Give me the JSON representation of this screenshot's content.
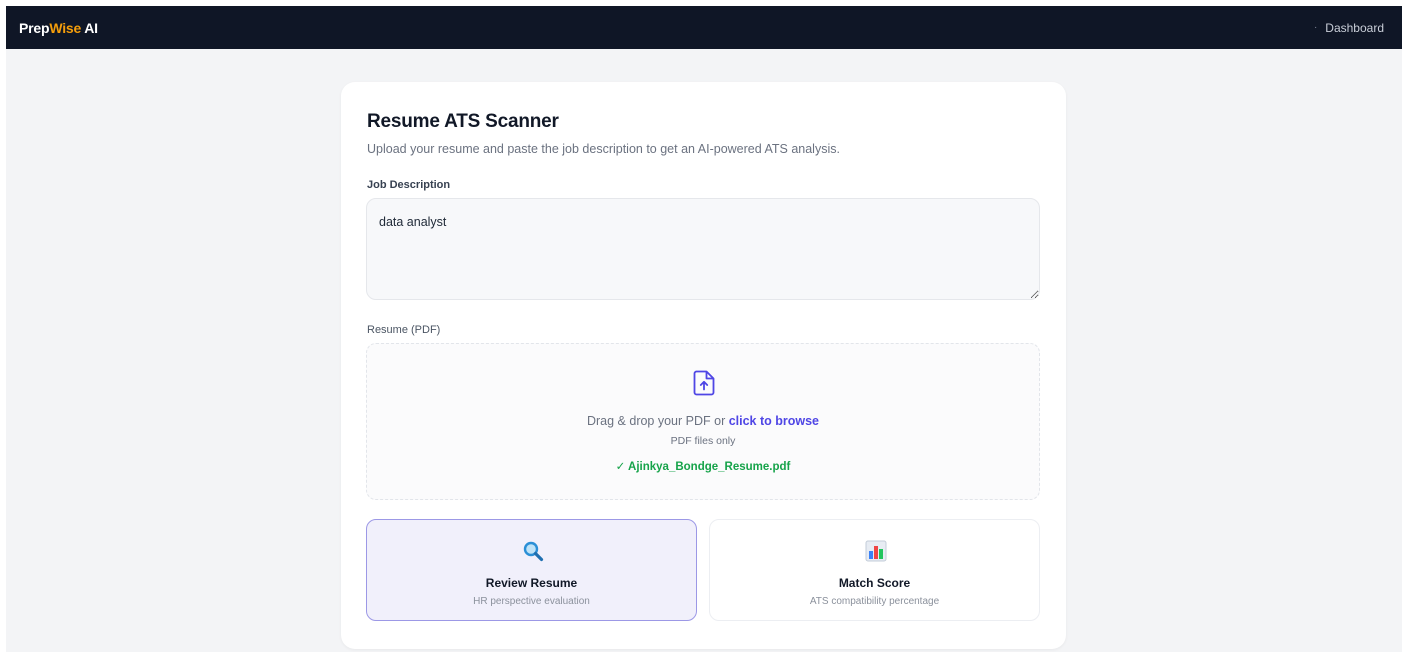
{
  "navbar": {
    "brand_prefix": "Prep",
    "brand_accent": "Wise",
    "brand_suffix": " AI",
    "link_bullet": "·",
    "link_label": "Dashboard"
  },
  "scanner": {
    "title": "Resume ATS Scanner",
    "subtitle": "Upload your resume and paste the job description to get an AI-powered ATS analysis.",
    "job_description": {
      "label": "Job Description",
      "value": "data analyst"
    },
    "resume": {
      "label": "Resume (PDF)",
      "icon": "file-upload-icon",
      "drop_text": "Drag & drop your PDF or ",
      "browse_text": "click to browse",
      "hint": "PDF files only",
      "file_name": "✓ Ajinkya_Bondge_Resume.pdf"
    },
    "actions": [
      {
        "icon": "magnifying-glass-icon",
        "title": "Review Resume",
        "description": "HR perspective evaluation",
        "selected": true
      },
      {
        "icon": "bar-chart-icon",
        "title": "Match Score",
        "description": "ATS compatibility percentage",
        "selected": false
      }
    ]
  },
  "colors": {
    "navbar_bg": "#0f1626",
    "brand_accent": "#f59e0b",
    "link_accent": "#4f46e5",
    "success": "#16a34a",
    "selected_border": "#9c98e6",
    "page_bg": "#f3f4f6"
  }
}
